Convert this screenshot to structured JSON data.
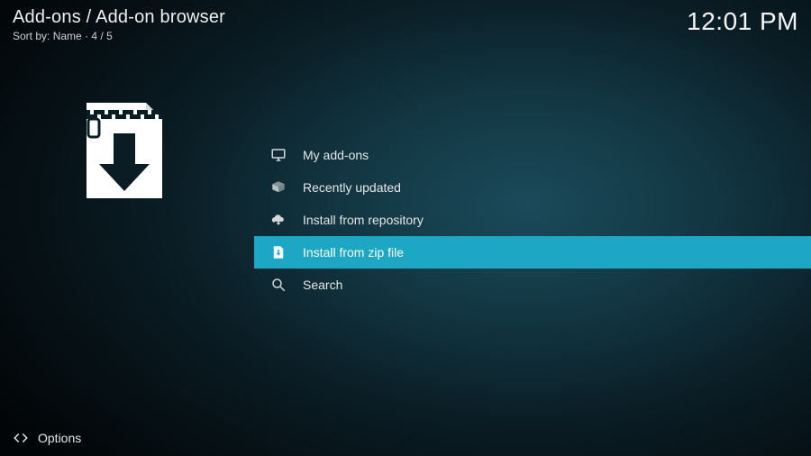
{
  "header": {
    "breadcrumb": "Add-ons / Add-on browser",
    "sort_label": "Sort by:",
    "sort_value": "Name",
    "position": "4 / 5",
    "clock": "12:01 PM"
  },
  "menu": {
    "items": [
      {
        "icon": "monitor-icon",
        "label": "My add-ons",
        "selected": false
      },
      {
        "icon": "box-open-icon",
        "label": "Recently updated",
        "selected": false
      },
      {
        "icon": "cloud-download-icon",
        "label": "Install from repository",
        "selected": false
      },
      {
        "icon": "zip-download-icon",
        "label": "Install from zip file",
        "selected": true
      },
      {
        "icon": "search-icon",
        "label": "Search",
        "selected": false
      }
    ]
  },
  "footer": {
    "options_label": "Options"
  }
}
